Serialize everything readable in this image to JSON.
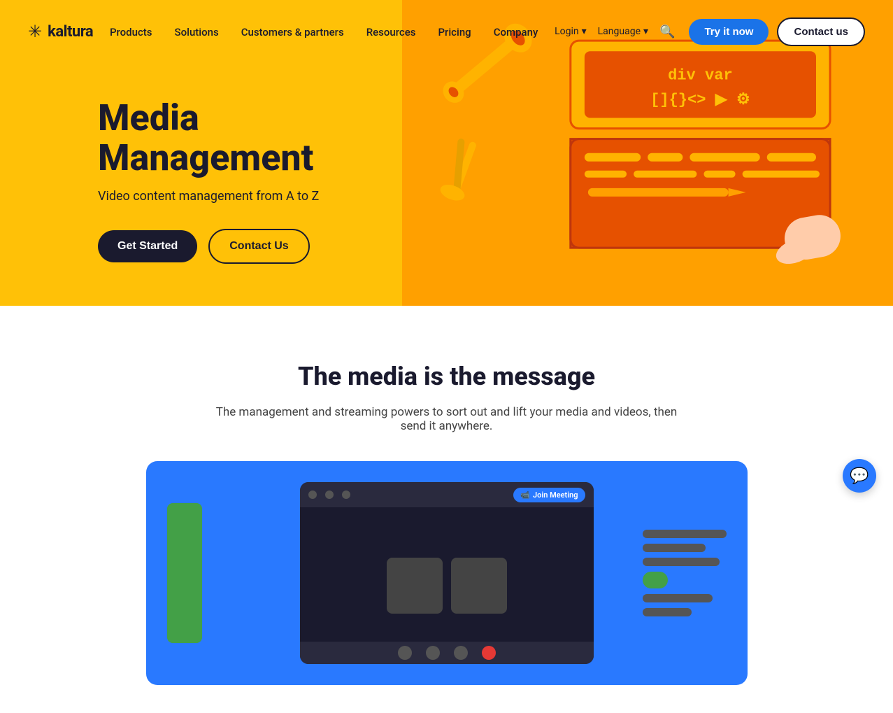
{
  "brand": {
    "name": "kaltura",
    "logo_icon": "✳",
    "tagline": "kaltura"
  },
  "nav": {
    "links": [
      {
        "label": "Products",
        "id": "products"
      },
      {
        "label": "Solutions",
        "id": "solutions"
      },
      {
        "label": "Customers & partners",
        "id": "customers-partners"
      },
      {
        "label": "Resources",
        "id": "resources"
      },
      {
        "label": "Pricing",
        "id": "pricing"
      },
      {
        "label": "Company",
        "id": "company"
      }
    ],
    "meta": [
      {
        "label": "Login",
        "id": "login",
        "has_chevron": true
      },
      {
        "label": "Language",
        "id": "language",
        "has_chevron": true
      }
    ],
    "cta_primary": "Try it now",
    "cta_secondary": "Contact us"
  },
  "hero": {
    "title": "Media Management",
    "subtitle": "Video content management from A to Z",
    "btn_primary": "Get Started",
    "btn_secondary": "Contact Us",
    "toolbox_code": "div var\n[]{}◁▶",
    "toolbox_symbols": "[ ] { } < > ▶ ⚙"
  },
  "section": {
    "heading": "The media is the message",
    "description": "The management and streaming powers to sort out and lift your media and videos, then send it anywhere."
  },
  "meeting": {
    "join_button": "Join Meeting",
    "video_icon": "📹"
  },
  "chat": {
    "icon": "💬"
  },
  "colors": {
    "hero_bg": "#FFC107",
    "hero_dark": "#E65100",
    "nav_cta_blue": "#1a73e8",
    "dark": "#1a1a2e",
    "section_blue": "#2979FF"
  }
}
